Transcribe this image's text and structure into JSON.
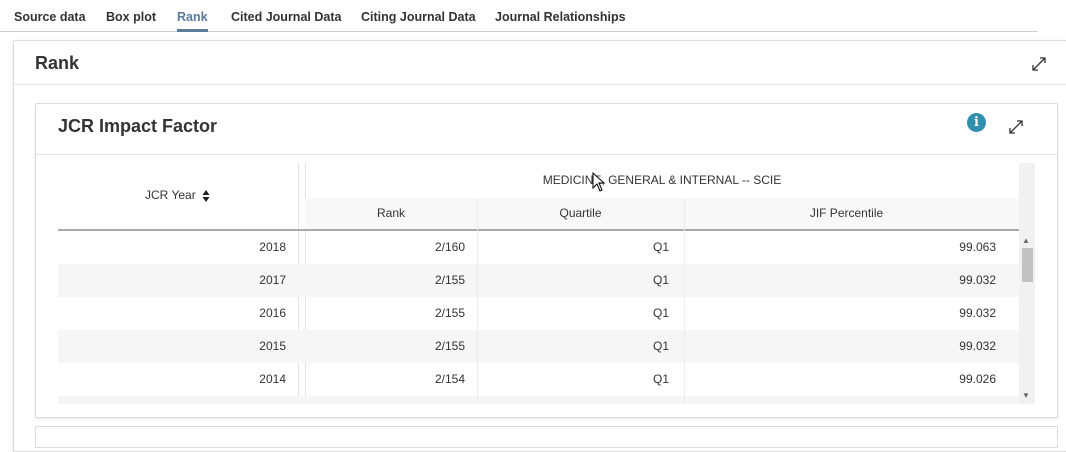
{
  "tabs": [
    {
      "label": "Source data"
    },
    {
      "label": "Box plot"
    },
    {
      "label": "Rank"
    },
    {
      "label": "Cited Journal Data"
    },
    {
      "label": "Citing Journal Data"
    },
    {
      "label": "Journal Relationships"
    }
  ],
  "active_tab": "Rank",
  "accent_color": "#5a7a98",
  "info_color": "#2f8fad",
  "panel": {
    "title": "Rank",
    "expand_icon": "expand-icon"
  },
  "card": {
    "title": "JCR Impact Factor",
    "info_label": "i",
    "info_icon": "info-icon",
    "expand_icon": "expand-icon"
  },
  "table": {
    "year_header": "JCR Year",
    "sort_icon": "sort-icon",
    "category_header": "MEDICINE, GENERAL & INTERNAL -- SCIE",
    "columns": [
      "Rank",
      "Quartile",
      "JIF Percentile"
    ],
    "rows": [
      {
        "year": "2018",
        "rank": "2/160",
        "quartile": "Q1",
        "percentile": "99.063"
      },
      {
        "year": "2017",
        "rank": "2/155",
        "quartile": "Q1",
        "percentile": "99.032"
      },
      {
        "year": "2016",
        "rank": "2/155",
        "quartile": "Q1",
        "percentile": "99.032"
      },
      {
        "year": "2015",
        "rank": "2/155",
        "quartile": "Q1",
        "percentile": "99.032"
      },
      {
        "year": "2014",
        "rank": "2/154",
        "quartile": "Q1",
        "percentile": "99.026"
      }
    ]
  }
}
